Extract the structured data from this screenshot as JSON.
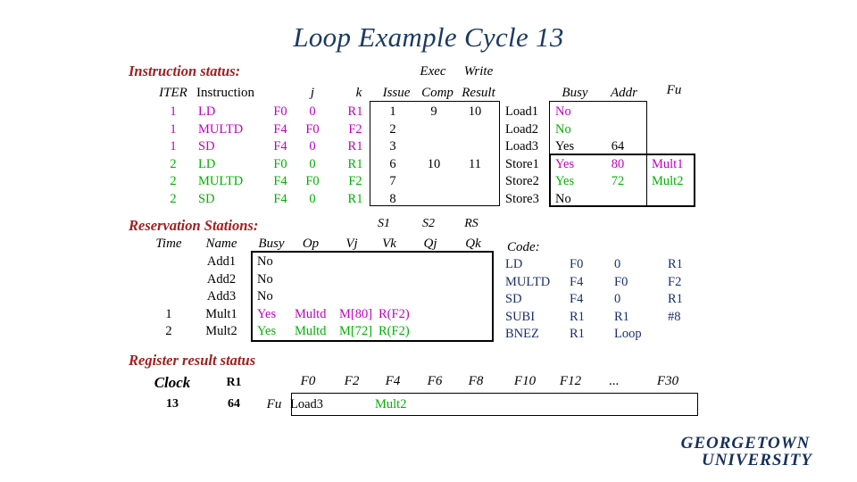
{
  "title": "Loop Example Cycle 13",
  "sections": {
    "instruction_status": "Instruction status:",
    "reservation_stations": "Reservation Stations:",
    "register_result_status": "Register result status",
    "code_label": "Code:"
  },
  "instruction_status": {
    "group_headers": {
      "exec": "Exec",
      "write": "Write"
    },
    "headers": [
      "ITER",
      "Instruction",
      "j",
      "k",
      "Issue",
      "Comp",
      "Result"
    ],
    "rows": [
      {
        "iter": "1",
        "instruction": "LD",
        "dest": "F0",
        "j": "0",
        "k": "R1",
        "issue": "1",
        "comp": "9",
        "result": "10",
        "color": "iter1"
      },
      {
        "iter": "1",
        "instruction": "MULTD",
        "dest": "F4",
        "j": "F0",
        "k": "F2",
        "issue": "2",
        "comp": "",
        "result": "",
        "color": "iter1"
      },
      {
        "iter": "1",
        "instruction": "SD",
        "dest": "F4",
        "j": "0",
        "k": "R1",
        "issue": "3",
        "comp": "",
        "result": "",
        "color": "iter1"
      },
      {
        "iter": "2",
        "instruction": "LD",
        "dest": "F0",
        "j": "0",
        "k": "R1",
        "issue": "6",
        "comp": "10",
        "result": "11",
        "color": "iter2"
      },
      {
        "iter": "2",
        "instruction": "MULTD",
        "dest": "F4",
        "j": "F0",
        "k": "F2",
        "issue": "7",
        "comp": "",
        "result": "",
        "color": "iter2"
      },
      {
        "iter": "2",
        "instruction": "SD",
        "dest": "F4",
        "j": "0",
        "k": "R1",
        "issue": "8",
        "comp": "",
        "result": "",
        "color": "iter2"
      }
    ]
  },
  "memory_units": {
    "headers": [
      "Busy",
      "Addr",
      "Fu"
    ],
    "rows": [
      {
        "name": "Load1",
        "busy": "No",
        "addr": "",
        "fu": "",
        "color": "iter1"
      },
      {
        "name": "Load2",
        "busy": "No",
        "addr": "",
        "fu": "",
        "color": "iter2"
      },
      {
        "name": "Load3",
        "busy": "Yes",
        "addr": "64",
        "fu": "",
        "color": "black"
      },
      {
        "name": "Store1",
        "busy": "Yes",
        "addr": "80",
        "fu": "Mult1",
        "color": "iter1"
      },
      {
        "name": "Store2",
        "busy": "Yes",
        "addr": "72",
        "fu": "Mult2",
        "color": "iter2"
      },
      {
        "name": "Store3",
        "busy": "No",
        "addr": "",
        "fu": "",
        "color": "black"
      }
    ]
  },
  "reservation_stations": {
    "group_headers": [
      "S1",
      "S2",
      "RS"
    ],
    "headers": [
      "Time",
      "Name",
      "Busy",
      "Op",
      "Vj",
      "Vk",
      "Qj",
      "Qk"
    ],
    "rows": [
      {
        "time": "",
        "name": "Add1",
        "busy": "No",
        "op": "",
        "vj": "",
        "vk": "",
        "qj": "",
        "qk": "",
        "color": "black"
      },
      {
        "time": "",
        "name": "Add2",
        "busy": "No",
        "op": "",
        "vj": "",
        "vk": "",
        "qj": "",
        "qk": "",
        "color": "black"
      },
      {
        "time": "",
        "name": "Add3",
        "busy": "No",
        "op": "",
        "vj": "",
        "vk": "",
        "qj": "",
        "qk": "",
        "color": "black"
      },
      {
        "time": "1",
        "name": "Mult1",
        "busy": "Yes",
        "op": "Multd",
        "vj": "M[80]",
        "vk": "R(F2)",
        "qj": "",
        "qk": "",
        "color": "iter1"
      },
      {
        "time": "2",
        "name": "Mult2",
        "busy": "Yes",
        "op": "Multd",
        "vj": "M[72]",
        "vk": "R(F2)",
        "qj": "",
        "qk": "",
        "color": "iter2"
      }
    ]
  },
  "code": {
    "lines": [
      {
        "op": "LD",
        "a": "F0",
        "b": "0",
        "c": "R1"
      },
      {
        "op": "MULTD",
        "a": "F4",
        "b": "F0",
        "c": "F2"
      },
      {
        "op": "SD",
        "a": "F4",
        "b": "0",
        "c": "R1"
      },
      {
        "op": "SUBI",
        "a": "R1",
        "b": "R1",
        "c": "#8"
      },
      {
        "op": "BNEZ",
        "a": "R1",
        "b": "Loop",
        "c": ""
      }
    ]
  },
  "register_status": {
    "clock_label": "Clock",
    "r1_label": "R1",
    "fu_label": "Fu",
    "clock_value": "13",
    "r1_value": "64",
    "registers": [
      "F0",
      "F2",
      "F4",
      "F6",
      "F8",
      "F10",
      "F12",
      "...",
      "F30"
    ],
    "values": [
      {
        "reg": "F0",
        "fu": "Load3",
        "color": "black"
      },
      {
        "reg": "F4",
        "fu": "Mult2",
        "color": "iter2"
      }
    ]
  },
  "logo": {
    "line1": "GEORGETOWN",
    "line2": "UNIVERSITY"
  },
  "colors": {
    "title": "#1b3a63",
    "section": "#a02020",
    "iter1": "#c000c0",
    "iter2": "#00b000",
    "black": "#000000",
    "code": "#1b2f6b"
  }
}
